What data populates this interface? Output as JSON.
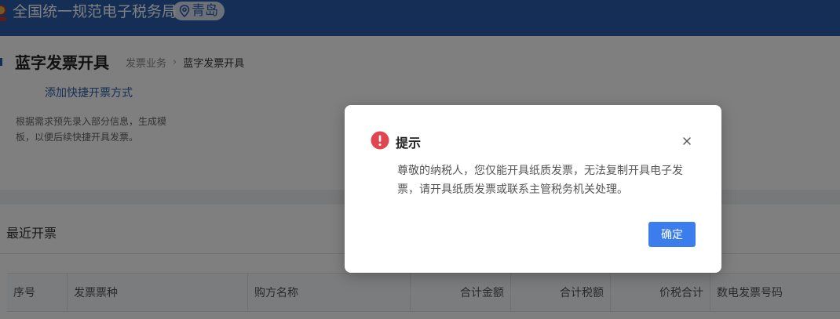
{
  "header": {
    "app_title": "全国统一规范电子税务局",
    "location": "青岛",
    "bg_color": "#2a5caa"
  },
  "page": {
    "title": "蓝字发票开具",
    "breadcrumb": [
      "发票业务",
      "蓝字发票开具"
    ],
    "add_link": "添加快捷开票方式",
    "description": "根据需求预先录入部分信息，生成模板，以便后续快捷开具发票。"
  },
  "recent": {
    "title": "最近开票",
    "columns": [
      "序号",
      "发票票种",
      "购方名称",
      "合计金额",
      "合计税额",
      "价税合计",
      "数电发票号码"
    ]
  },
  "dialog": {
    "title": "提示",
    "message": "尊敬的纳税人，您仅能开具纸质发票，无法复制开具电子发票，请开具纸质发票或联系主管税务机关处理。",
    "confirm_label": "确定",
    "icon": "exclamation-circle-icon",
    "icon_color": "#e04550",
    "button_color": "#3b7ded"
  }
}
